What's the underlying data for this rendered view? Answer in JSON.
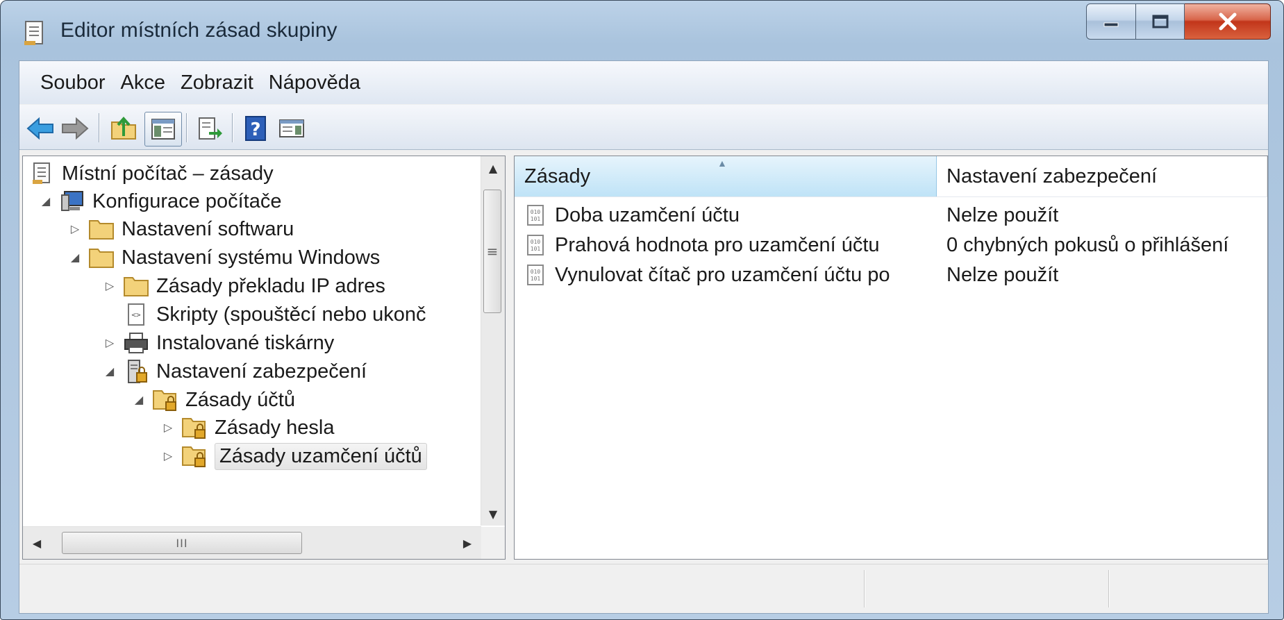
{
  "window": {
    "title": "Editor místních zásad skupiny",
    "icon": "policy-document-icon"
  },
  "menu": [
    "Soubor",
    "Akce",
    "Zobrazit",
    "Nápověda"
  ],
  "toolbar": {
    "buttons": [
      "back-arrow-icon",
      "forward-arrow-icon",
      "up-folder-icon",
      "show-hide-tree-icon",
      "export-list-icon",
      "help-icon",
      "action-pane-icon"
    ]
  },
  "tree": {
    "items": [
      {
        "label": "Místní počítač – zásady",
        "expander": "",
        "icon": "policy-document-icon"
      },
      {
        "label": "Konfigurace počítače",
        "expander": "◢",
        "icon": "computer-icon"
      },
      {
        "label": "Nastavení softwaru",
        "expander": "▷",
        "icon": "folder-icon"
      },
      {
        "label": "Nastavení systému Windows",
        "expander": "◢",
        "icon": "folder-icon"
      },
      {
        "label": "Zásady překladu IP adres",
        "expander": "▷",
        "icon": "folder-icon"
      },
      {
        "label": "Skripty (spouštěcí nebo ukonč",
        "expander": "",
        "icon": "script-icon"
      },
      {
        "label": "Instalované tiskárny",
        "expander": "▷",
        "icon": "printer-icon"
      },
      {
        "label": "Nastavení zabezpečení",
        "expander": "◢",
        "icon": "security-server-icon"
      },
      {
        "label": "Zásady účtů",
        "expander": "◢",
        "icon": "locked-folder-icon"
      },
      {
        "label": "Zásady hesla",
        "expander": "▷",
        "icon": "locked-folder-icon"
      },
      {
        "label": "Zásady uzamčení účtů",
        "expander": "▷",
        "icon": "locked-folder-icon"
      }
    ]
  },
  "list": {
    "columns": [
      "Zásady",
      "Nastavení zabezpečení"
    ],
    "rows": [
      {
        "policy": "Doba uzamčení účtu",
        "setting": "Nelze použít"
      },
      {
        "policy": "Prahová hodnota pro uzamčení účtu",
        "setting": "0 chybných pokusů o přihlášení"
      },
      {
        "policy": "Vynulovat čítač pro uzamčení účtu po",
        "setting": "Nelze použít"
      }
    ]
  },
  "colors": {
    "selected_header": "#bfe3f7",
    "folder": "#f3d27a",
    "close_button": "#c2351a"
  }
}
